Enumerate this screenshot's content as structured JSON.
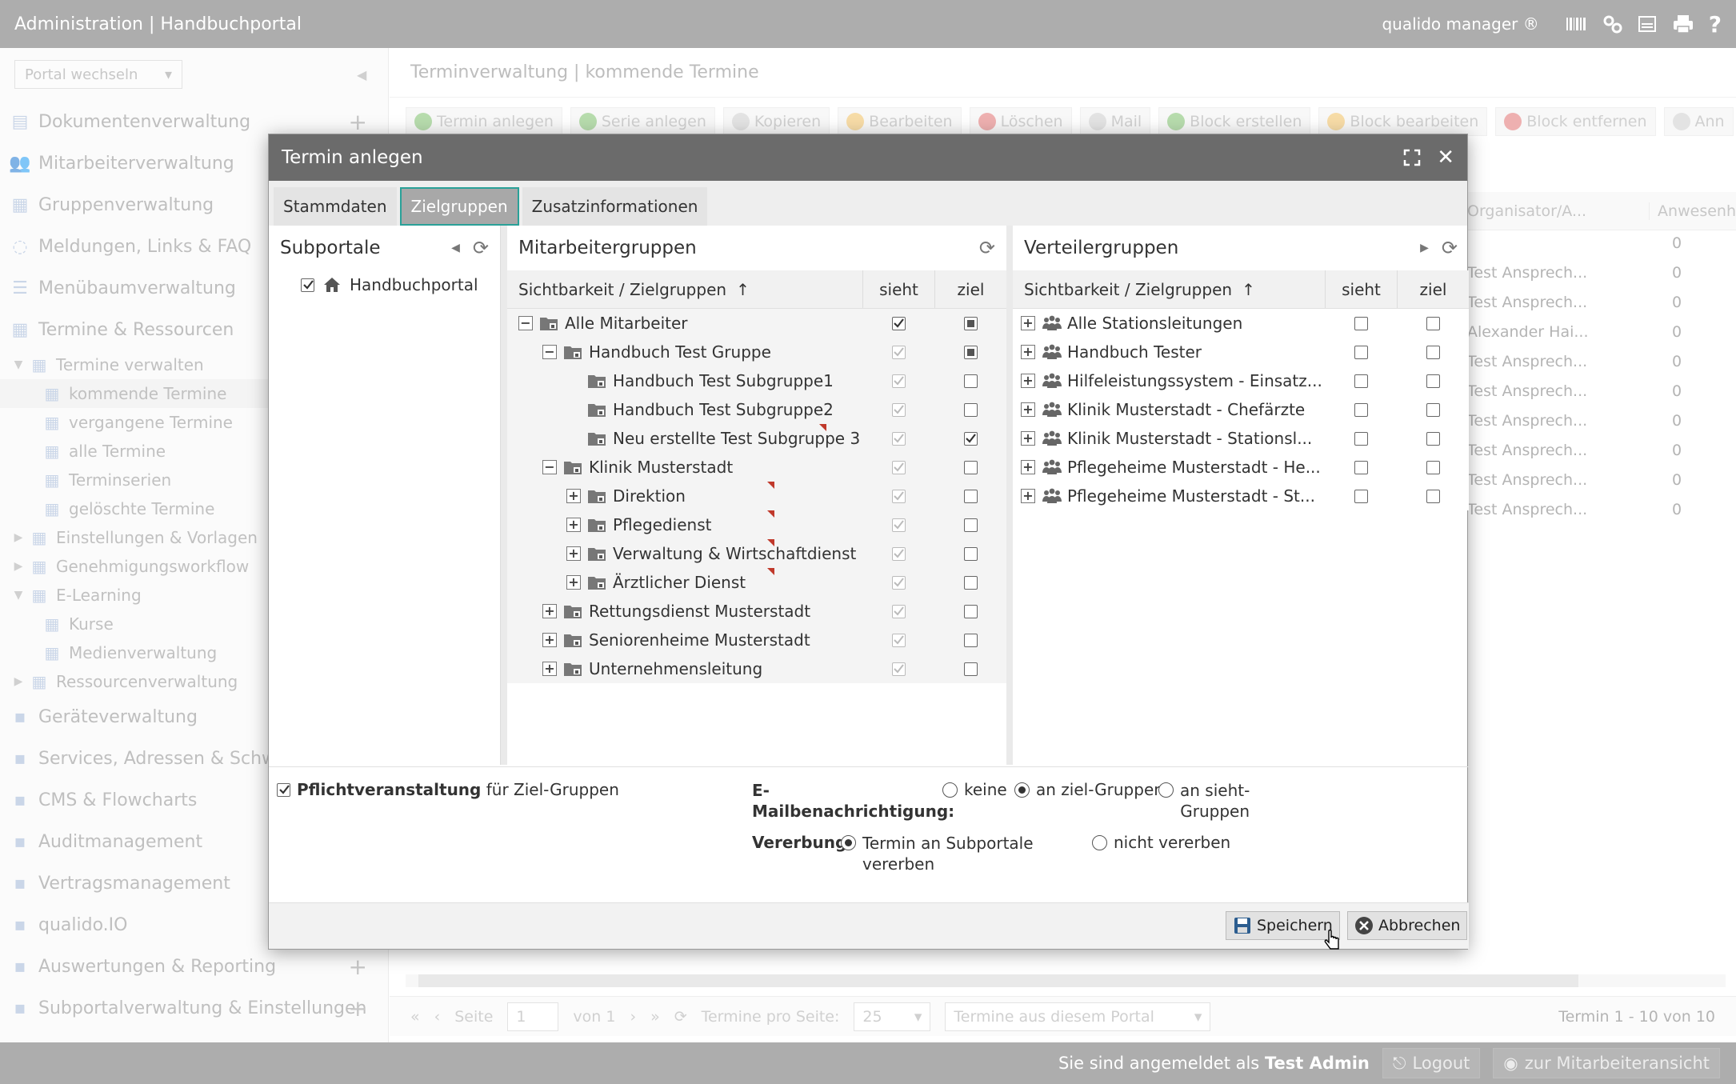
{
  "topbar": {
    "title": "Administration | Handbuchportal",
    "brand": "qualido manager ®"
  },
  "sidebar": {
    "portal_select": "Portal wechseln",
    "items": [
      {
        "label": "Dokumentenverwaltung",
        "icon": "documents-icon"
      },
      {
        "label": "Mitarbeiterverwaltung",
        "icon": "users-icon"
      },
      {
        "label": "Gruppenverwaltung",
        "icon": "groups-icon"
      },
      {
        "label": "Meldungen, Links & FAQ",
        "icon": "chat-icon"
      },
      {
        "label": "Menübaumverwaltung",
        "icon": "list-icon"
      },
      {
        "label": "Termine & Ressourcen",
        "icon": "calendar-icon"
      }
    ],
    "sub": [
      {
        "label": "Termine verwalten",
        "level": 1
      },
      {
        "label": "kommende Termine",
        "level": 2
      },
      {
        "label": "vergangene Termine",
        "level": 2
      },
      {
        "label": "alle Termine",
        "level": 2
      },
      {
        "label": "Terminserien",
        "level": 2
      },
      {
        "label": "gelöschte Termine",
        "level": 2
      },
      {
        "label": "Einstellungen & Vorlagen",
        "level": 1
      },
      {
        "label": "Genehmigungsworkflow",
        "level": 1
      },
      {
        "label": "E-Learning",
        "level": 1
      },
      {
        "label": "Kurse",
        "level": 2
      },
      {
        "label": "Medienverwaltung",
        "level": 2
      },
      {
        "label": "Ressourcenverwaltung",
        "level": 1
      }
    ],
    "items2": [
      {
        "label": "Geräteverwaltung"
      },
      {
        "label": "Services, Adressen & Schwarz"
      },
      {
        "label": "CMS & Flowcharts"
      },
      {
        "label": "Auditmanagement"
      },
      {
        "label": "Vertragsmanagement"
      },
      {
        "label": "qualido.IO"
      },
      {
        "label": "Auswertungen & Reporting"
      },
      {
        "label": "Subportalverwaltung & Einstellungen"
      }
    ]
  },
  "main": {
    "header": "Terminverwaltung | kommende Termine",
    "toolbar": [
      "Termin anlegen",
      "Serie anlegen",
      "Kopieren",
      "Bearbeiten",
      "Löschen",
      "Mail",
      "Block erstellen",
      "Block bearbeiten",
      "Block entfernen",
      "Ann"
    ],
    "columns": [
      "Organisator/A...",
      "Anwesenh"
    ],
    "rows": [
      {
        "org": "",
        "anw": "0"
      },
      {
        "org": "Test Ansprech...",
        "anw": "0"
      },
      {
        "org": "Test Ansprech...",
        "anw": "0"
      },
      {
        "org": "Alexander Hai...",
        "anw": "0"
      },
      {
        "org": "Test Ansprech...",
        "anw": "0"
      },
      {
        "org": "Test Ansprech...",
        "anw": "0"
      },
      {
        "org": "Test Ansprech...",
        "anw": "0"
      },
      {
        "org": "Test Ansprech...",
        "anw": "0"
      },
      {
        "org": "Test Ansprech...",
        "anw": "0"
      },
      {
        "org": "Test Ansprech...",
        "anw": "0"
      }
    ]
  },
  "pager": {
    "seite": "Seite",
    "page": "1",
    "von": "von 1",
    "per_page_label": "Termine pro Seite:",
    "per_page": "25",
    "filter": "Termine aus diesem Portal",
    "summary": "Termin 1 - 10 von 10"
  },
  "footer": {
    "logged_in": "Sie sind angemeldet als",
    "user": "Test Admin",
    "logout": "Logout",
    "switch": "zur Mitarbeiteransicht"
  },
  "dialog": {
    "title": "Termin anlegen",
    "tabs": [
      "Stammdaten",
      "Zielgruppen",
      "Zusatzinformationen"
    ],
    "subportale": {
      "title": "Subportale",
      "item": "Handbuchportal"
    },
    "mitarbeiter": {
      "title": "Mitarbeitergruppen",
      "col": "Sichtbarkeit / Zielgruppen",
      "sieht": "sieht",
      "ziel": "ziel",
      "rows": [
        {
          "label": "Alle Mitarbeiter",
          "indent": 0,
          "toggle": "−",
          "sieht": "checked",
          "ziel": "tri",
          "mark": false
        },
        {
          "label": "Handbuch Test Gruppe",
          "indent": 1,
          "toggle": "−",
          "sieht": "dis",
          "ziel": "tri",
          "mark": false
        },
        {
          "label": "Handbuch Test Subgruppe1",
          "indent": 2,
          "toggle": "",
          "sieht": "dis",
          "ziel": "empty",
          "mark": false
        },
        {
          "label": "Handbuch Test Subgruppe2",
          "indent": 2,
          "toggle": "",
          "sieht": "dis",
          "ziel": "empty",
          "mark": false
        },
        {
          "label": "Neu erstellte Test Subgruppe 3",
          "indent": 2,
          "toggle": "",
          "sieht": "dis",
          "ziel": "checked",
          "mark": true
        },
        {
          "label": "Klinik Musterstadt",
          "indent": 1,
          "toggle": "−",
          "sieht": "dis",
          "ziel": "empty",
          "mark": false
        },
        {
          "label": "Direktion",
          "indent": 2,
          "toggle": "+",
          "sieht": "dis",
          "ziel": "empty",
          "mark": true
        },
        {
          "label": "Pflegedienst",
          "indent": 2,
          "toggle": "+",
          "sieht": "dis",
          "ziel": "empty",
          "mark": true
        },
        {
          "label": "Verwaltung & Wirtschaftdienst",
          "indent": 2,
          "toggle": "+",
          "sieht": "dis",
          "ziel": "empty",
          "mark": true
        },
        {
          "label": "Ärztlicher Dienst",
          "indent": 2,
          "toggle": "+",
          "sieht": "dis",
          "ziel": "empty",
          "mark": true
        },
        {
          "label": "Rettungsdienst Musterstadt",
          "indent": 1,
          "toggle": "+",
          "sieht": "dis",
          "ziel": "empty",
          "mark": false
        },
        {
          "label": "Seniorenheime Musterstadt",
          "indent": 1,
          "toggle": "+",
          "sieht": "dis",
          "ziel": "empty",
          "mark": false
        },
        {
          "label": "Unternehmensleitung",
          "indent": 1,
          "toggle": "+",
          "sieht": "dis",
          "ziel": "empty",
          "mark": false
        }
      ]
    },
    "verteiler": {
      "title": "Verteilergruppen",
      "col": "Sichtbarkeit / Zielgruppen",
      "sieht": "sieht",
      "ziel": "ziel",
      "rows": [
        "Alle Stationsleitungen",
        "Handbuch Tester",
        "Hilfeleistungssystem - Einsatz...",
        "Klinik Musterstadt - Chefärzte",
        "Klinik Musterstadt - Stationsl...",
        "Pflegeheime Musterstadt - He...",
        "Pflegeheime Musterstadt - St..."
      ]
    },
    "pflicht_bold": "Pflichtveranstaltung",
    "pflicht_rest": "für Ziel-Gruppen",
    "email_label_1": "E-",
    "email_label_2": "Mailbenachrichtigung:",
    "email_opts": [
      "keine",
      "an ziel-Gruppen",
      "an sieht-",
      "Gruppen"
    ],
    "vererbung_label": "Vererbung:",
    "vererbung_opt1a": "Termin an Subportale",
    "vererbung_opt1b": "vererben",
    "vererbung_opt2": "nicht vererben",
    "save": "Speichern",
    "cancel": "Abbrechen"
  }
}
